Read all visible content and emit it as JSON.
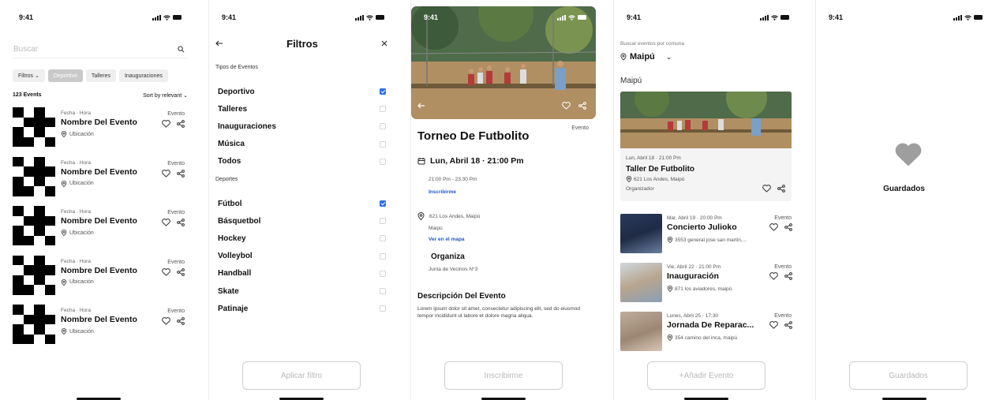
{
  "status": {
    "time": "9:41"
  },
  "events_screen": {
    "search_placeholder": "Buscar",
    "chips": [
      "Filtros ⌄",
      "Deportivo",
      "Talleres",
      "Inauguraciones"
    ],
    "count": "123 Events",
    "sort": "Sort by relevant",
    "event": {
      "meta": "Fecha · Hora",
      "title": "Nombre Del Evento",
      "location": "Ubicación",
      "tag": "Evento"
    }
  },
  "filters_screen": {
    "title": "Filtros",
    "section_types": "Tipos de Eventos",
    "types": [
      {
        "label": "Deportivo",
        "checked": true
      },
      {
        "label": "Talleres",
        "checked": false
      },
      {
        "label": "Inauguraciones",
        "checked": false
      },
      {
        "label": "Música",
        "checked": false
      },
      {
        "label": "Todos",
        "checked": false
      }
    ],
    "section_sports": "Deportes",
    "sports": [
      {
        "label": "Fútbol",
        "checked": true
      },
      {
        "label": "Básquetbol",
        "checked": false
      },
      {
        "label": "Hockey",
        "checked": false
      },
      {
        "label": "Volleybol",
        "checked": false
      },
      {
        "label": "Handball",
        "checked": false
      },
      {
        "label": "Skate",
        "checked": false
      },
      {
        "label": "Patinaje",
        "checked": false
      }
    ],
    "apply_button": "Aplicar filtro"
  },
  "detail_screen": {
    "title": "Torneo De Futbolito",
    "tag": "Evento",
    "date": "Lun, Abril 18 · 21:00 Pm",
    "time_range": "21:00 Pm - 23.30 Pm",
    "register_link": "Inscribirme",
    "address": "621 Los Andes, Maipú",
    "city": "Maipú",
    "map_link": "Ver en el mapa",
    "organizer_title": "Organiza",
    "organizer": "Junta de Vecinos N°3",
    "description_title": "Descripción Del Evento",
    "description": "Lorem ipsum dolor sit amet, consectetur adipiscing elit, sed do eiusmod tempor incididunt ut labore et dolore magna aliqua.",
    "register_button": "Inscribirme"
  },
  "commune_screen": {
    "label": "Buscar eventos por comuna",
    "selected": "Maipú",
    "section": "Maipú",
    "featured": {
      "meta": "Lun, Abril 18 · 21:00 Pm",
      "title": "Taller De Futbolito",
      "location": "621 Los Andes, Maipú",
      "organizer": "Organizador"
    },
    "events": [
      {
        "meta": "Mar, Abril 19 · 20:00 Pm",
        "tag": "Evento",
        "title": "Concierto Julioko",
        "location": "3553 general jose san martin,..."
      },
      {
        "meta": "Vie, Abril 22 · 21:00 Pm",
        "tag": "Evento",
        "title": "Inauguración",
        "location": "871 los aviadores, maipú"
      },
      {
        "meta": "Lunes, Abril 25 · 17:30",
        "tag": "Evento",
        "title": "Jornada De Reparac...",
        "location": "354 camino del inca, maipú"
      }
    ],
    "add_button": "+Añadir Evento"
  },
  "saved_screen": {
    "title": "Guardados",
    "button": "Guardados"
  }
}
